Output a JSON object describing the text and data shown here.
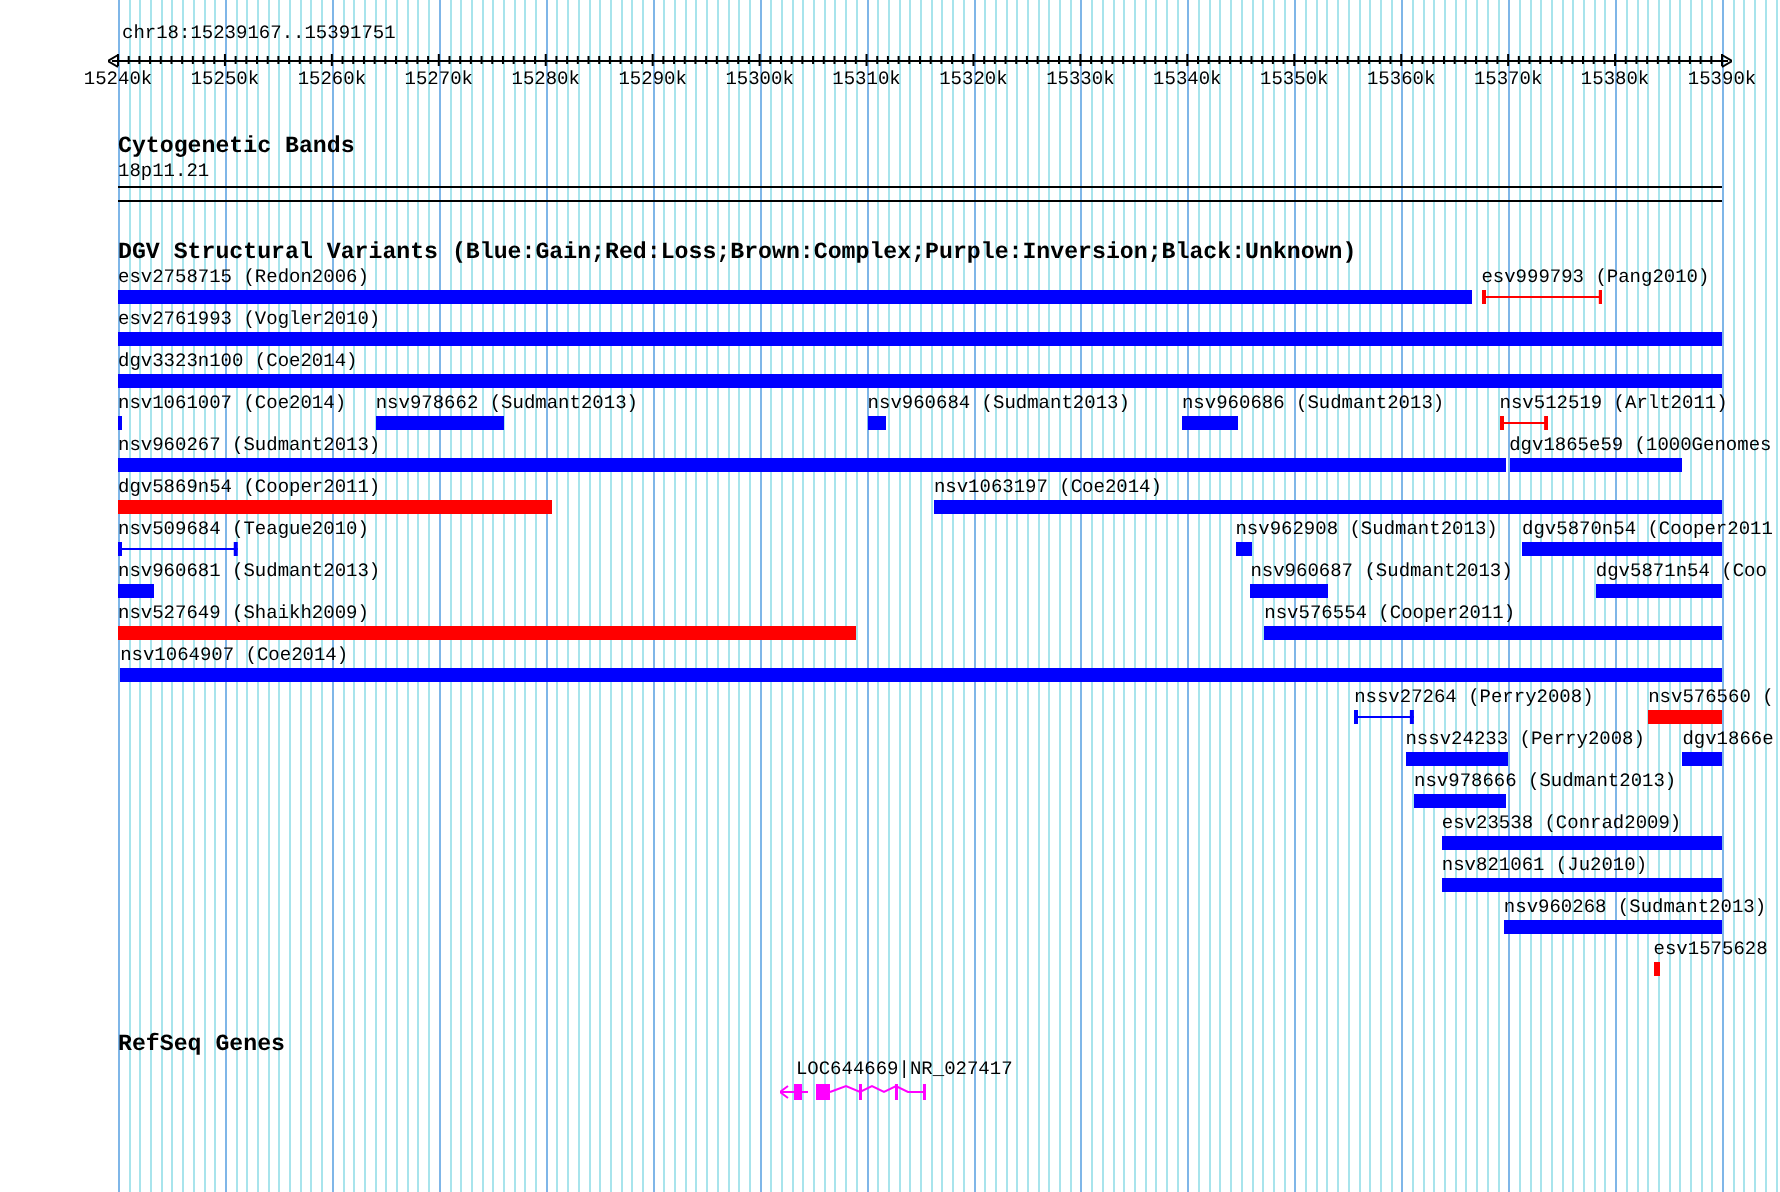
{
  "ruler": {
    "location": "chr18:15239167..15391751",
    "labels": [
      "15240k",
      "15250k",
      "15260k",
      "15270k",
      "15280k",
      "15290k",
      "15300k",
      "15310k",
      "15320k",
      "15330k",
      "15340k",
      "15350k",
      "15360k",
      "15370k",
      "15380k",
      "15390k"
    ]
  },
  "cytogenetic_bands": {
    "title": "Cytogenetic Bands",
    "band": "18p11.21"
  },
  "dgv": {
    "title": "DGV Structural Variants (Blue:Gain;Red:Loss;Brown:Complex;Purple:Inversion;Black:Unknown)",
    "rows": [
      {
        "features": [
          {
            "label": "esv2758715 (Redon2006)",
            "color": "#0000ff",
            "kind": "bar"
          },
          {
            "label": "esv999793 (Pang2010)",
            "color": "#ff0000",
            "kind": "line"
          }
        ]
      },
      {
        "features": [
          {
            "label": "esv2761993 (Vogler2010)",
            "color": "#0000ff",
            "kind": "bar"
          }
        ]
      },
      {
        "features": [
          {
            "label": "dgv3323n100 (Coe2014)",
            "color": "#0000ff",
            "kind": "bar"
          }
        ]
      },
      {
        "features": [
          {
            "label": "nsv1061007 (Coe2014)",
            "color": "#0000ff",
            "kind": "bar"
          },
          {
            "label": "nsv978662 (Sudmant2013)",
            "color": "#0000ff",
            "kind": "bar"
          },
          {
            "label": "nsv960684 (Sudmant2013)",
            "color": "#0000ff",
            "kind": "bar"
          },
          {
            "label": "nsv960686 (Sudmant2013)",
            "color": "#0000ff",
            "kind": "bar"
          },
          {
            "label": "nsv512519 (Arlt2011)",
            "color": "#ff0000",
            "kind": "line"
          }
        ]
      },
      {
        "features": [
          {
            "label": "nsv960267 (Sudmant2013)",
            "color": "#0000ff",
            "kind": "bar"
          },
          {
            "label": "dgv1865e59 (1000Genomes",
            "color": "#0000ff",
            "kind": "bar"
          }
        ]
      },
      {
        "features": [
          {
            "label": "dgv5869n54 (Cooper2011)",
            "color": "#ff0000",
            "kind": "bar"
          },
          {
            "label": "nsv1063197 (Coe2014)",
            "color": "#0000ff",
            "kind": "bar"
          }
        ]
      },
      {
        "features": [
          {
            "label": "nsv509684 (Teague2010)",
            "color": "#0000ff",
            "kind": "line"
          },
          {
            "label": "nsv962908 (Sudmant2013)",
            "color": "#0000ff",
            "kind": "bar"
          },
          {
            "label": "dgv5870n54 (Cooper2011",
            "color": "#0000ff",
            "kind": "bar"
          }
        ]
      },
      {
        "features": [
          {
            "label": "nsv960681 (Sudmant2013)",
            "color": "#0000ff",
            "kind": "bar"
          },
          {
            "label": "nsv960687 (Sudmant2013)",
            "color": "#0000ff",
            "kind": "bar"
          },
          {
            "label": "dgv5871n54 (Coo",
            "color": "#0000ff",
            "kind": "bar"
          }
        ]
      },
      {
        "features": [
          {
            "label": "nsv527649 (Shaikh2009)",
            "color": "#ff0000",
            "kind": "bar"
          },
          {
            "label": "nsv576554 (Cooper2011)",
            "color": "#0000ff",
            "kind": "bar"
          }
        ]
      },
      {
        "features": [
          {
            "label": "nsv1064907 (Coe2014)",
            "color": "#0000ff",
            "kind": "bar"
          }
        ]
      },
      {
        "features": [
          {
            "label": "nssv27264 (Perry2008)",
            "color": "#0000ff",
            "kind": "line"
          },
          {
            "label": "nsv576560 (",
            "color": "#ff0000",
            "kind": "bar"
          }
        ]
      },
      {
        "features": [
          {
            "label": "nssv24233 (Perry2008)",
            "color": "#0000ff",
            "kind": "bar"
          },
          {
            "label": "dgv1866e",
            "color": "#0000ff",
            "kind": "bar"
          }
        ]
      },
      {
        "features": [
          {
            "label": "nsv978666 (Sudmant2013)",
            "color": "#0000ff",
            "kind": "bar"
          }
        ]
      },
      {
        "features": [
          {
            "label": "esv23538 (Conrad2009)",
            "color": "#0000ff",
            "kind": "bar"
          }
        ]
      },
      {
        "features": [
          {
            "label": "nsv821061 (Ju2010)",
            "color": "#0000ff",
            "kind": "bar"
          }
        ]
      },
      {
        "features": [
          {
            "label": "nsv960268 (Sudmant2013)",
            "color": "#0000ff",
            "kind": "bar"
          }
        ]
      },
      {
        "features": [
          {
            "label": "esv1575628",
            "color": "#ff0000",
            "kind": "bar"
          }
        ]
      }
    ]
  },
  "refseq": {
    "title": "RefSeq Genes",
    "genes": [
      {
        "label": "LOC644669|NR_027417"
      }
    ]
  }
}
